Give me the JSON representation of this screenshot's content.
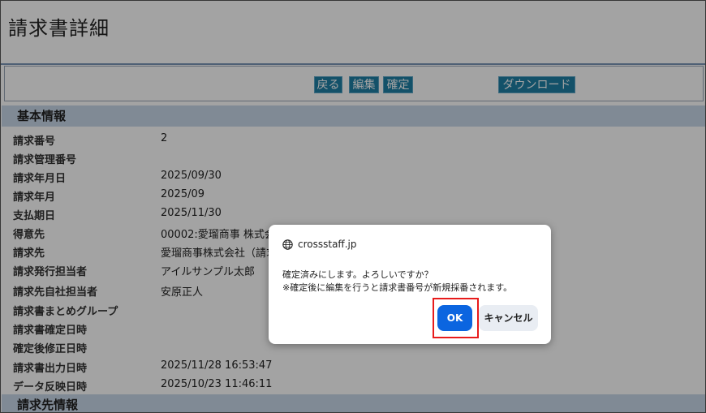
{
  "page": {
    "title": "請求書詳細"
  },
  "toolbar": {
    "back_label": "戻る",
    "edit_label": "編集",
    "confirm_label": "確定",
    "download_label": "ダウンロード"
  },
  "sections": {
    "basic_info": "基本情報",
    "billing_info": "請求先情報"
  },
  "basic_info_rows": [
    {
      "label": "請求番号",
      "value": "2"
    },
    {
      "label": "請求管理番号",
      "value": ""
    },
    {
      "label": "請求年月日",
      "value": "2025/09/30"
    },
    {
      "label": "請求年月",
      "value": "2025/09"
    },
    {
      "label": "支払期日",
      "value": "2025/11/30"
    },
    {
      "label": "得意先",
      "value": "00002:愛瑠商事 株式会社"
    },
    {
      "label": "請求先",
      "value": "愛瑠商事株式会社（請求"
    },
    {
      "label": "請求発行担当者",
      "value": "アイルサンプル太郎"
    },
    {
      "label": "請求先自社担当者",
      "value": "安原正人"
    },
    {
      "label": "請求書まとめグループ",
      "value": ""
    },
    {
      "label": "請求書確定日時",
      "value": ""
    },
    {
      "label": "確定後修正日時",
      "value": ""
    },
    {
      "label": "請求書出力日時",
      "value": "2025/11/28 16:53:47"
    },
    {
      "label": "データ反映日時",
      "value": "2025/10/23 11:46:11"
    }
  ],
  "dialog": {
    "origin": "crossstaff.jp",
    "message_line1": "確定済みにします。よろしいですか？",
    "message_line2": "※確定後に編集を行うと請求書番号が新規採番されます。",
    "ok_label": "OK",
    "cancel_label": "キャンセル"
  },
  "colors": {
    "button_bg": "#1f7fa5",
    "section_bg": "#c9d8ea",
    "ok_bg": "#0b65e0",
    "highlight": "#e81b1b"
  }
}
